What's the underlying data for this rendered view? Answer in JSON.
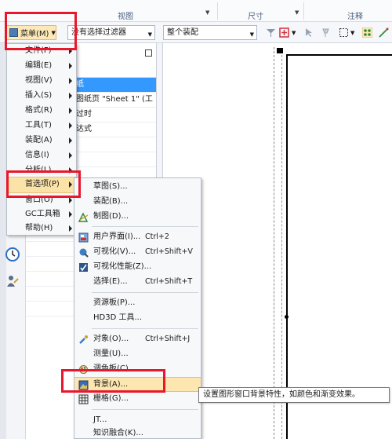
{
  "ribbon": {
    "groups": [
      "视图",
      "尺寸",
      "注释"
    ]
  },
  "toolbar": {
    "menu_button": "菜单(M)",
    "filter_select": "没有选择过滤器",
    "assembly_select": "整个装配"
  },
  "nav_panel": {
    "rows": [
      "纸",
      "图纸页 \"Sheet 1\" (工",
      "过时",
      "达式"
    ]
  },
  "main_menu": {
    "items": [
      {
        "label": "文件(F)",
        "submenu": true
      },
      {
        "label": "编辑(E)",
        "submenu": true
      },
      {
        "label": "视图(V)",
        "submenu": true
      },
      {
        "label": "插入(S)",
        "submenu": true
      },
      {
        "label": "格式(R)",
        "submenu": true
      },
      {
        "label": "工具(T)",
        "submenu": true
      },
      {
        "label": "装配(A)",
        "submenu": true
      },
      {
        "label": "信息(I)",
        "submenu": true
      },
      {
        "label": "分析(L)",
        "submenu": true
      },
      {
        "label": "首选项(P)",
        "submenu": true,
        "active": true
      },
      {
        "label": "窗口(O)",
        "submenu": true
      },
      {
        "label": "GC工具箱",
        "submenu": true
      },
      {
        "label": "帮助(H)",
        "submenu": true
      }
    ]
  },
  "preferences_menu": {
    "items": [
      {
        "label": "草图(S)...",
        "shortcut": ""
      },
      {
        "label": "装配(B)...",
        "shortcut": ""
      },
      {
        "label": "制图(D)...",
        "shortcut": ""
      },
      {
        "label": "用户界面(I)...",
        "shortcut": "Ctrl+2"
      },
      {
        "label": "可视化(V)...",
        "shortcut": "Ctrl+Shift+V"
      },
      {
        "label": "可视化性能(Z)...",
        "shortcut": ""
      },
      {
        "label": "选择(E)...",
        "shortcut": "Ctrl+Shift+T"
      },
      {
        "label": "资源板(P)...",
        "shortcut": ""
      },
      {
        "label": "HD3D 工具...",
        "shortcut": ""
      },
      {
        "label": "对象(O)...",
        "shortcut": "Ctrl+Shift+J"
      },
      {
        "label": "测量(U)...",
        "shortcut": ""
      },
      {
        "label": "调色板(C)...",
        "shortcut": ""
      },
      {
        "label": "背景(A)...",
        "shortcut": "",
        "highlighted": true
      },
      {
        "label": "栅格(G)...",
        "shortcut": ""
      },
      {
        "label": "JT...",
        "shortcut": ""
      },
      {
        "label": "知识融合(K)...",
        "shortcut": ""
      }
    ]
  },
  "tooltip": "设置图形窗口背景特性，如颜色和渐变效果。",
  "colors": {
    "highlight": "#fde6b0",
    "annotation_red": "#e8172b",
    "selection_blue": "#3399ff"
  },
  "icons": [
    "menu-icon",
    "filter-icon",
    "snap-icon",
    "select-box-icon",
    "clock-icon",
    "roles-icon"
  ]
}
